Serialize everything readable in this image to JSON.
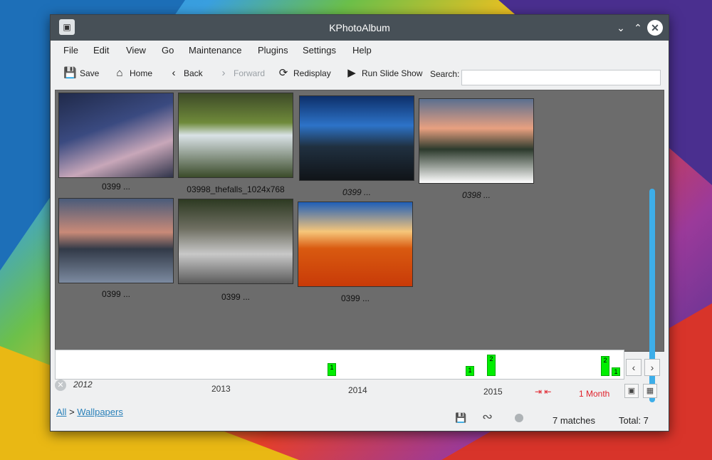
{
  "window": {
    "title": "KPhotoAlbum"
  },
  "menu": [
    "File",
    "Edit",
    "View",
    "Go",
    "Maintenance",
    "Plugins",
    "Settings",
    "Help"
  ],
  "toolbar": {
    "save": "Save",
    "home": "Home",
    "back": "Back",
    "forward": "Forward",
    "redisplay": "Redisplay",
    "slideshow": "Run Slide Show",
    "search_label": "Search:"
  },
  "thumbnails": [
    {
      "caption": "0399 ..."
    },
    {
      "caption": "03998_thefalls_1024x768"
    },
    {
      "caption": "0399 ..."
    },
    {
      "caption": "0398 ..."
    },
    {
      "caption": "0399 ..."
    },
    {
      "caption": "0399 ..."
    },
    {
      "caption": "0399 ..."
    }
  ],
  "timeline": {
    "years": [
      "2012",
      "2013",
      "2014",
      "2015"
    ],
    "bars": [
      "1",
      "1",
      "2",
      "2",
      "1"
    ],
    "unit": "1 Month"
  },
  "status": {
    "breadcrumb_root": "All",
    "breadcrumb_sep": ">",
    "breadcrumb_current": "Wallpapers",
    "matches": "7 matches",
    "total": "Total: 7"
  }
}
